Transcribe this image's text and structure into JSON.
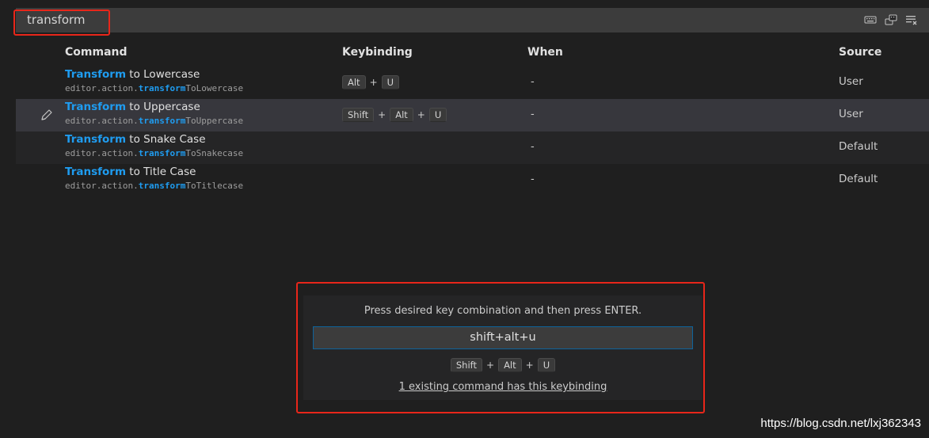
{
  "search": {
    "value": "transform"
  },
  "toolbar": {
    "icons": [
      "keyboard-icon",
      "record-keys-icon",
      "clear-search-icon"
    ]
  },
  "table": {
    "headers": {
      "command": "Command",
      "keybinding": "Keybinding",
      "when": "When",
      "source": "Source"
    },
    "rows": [
      {
        "title_hl": "Transform",
        "title_rest": " to Lowercase",
        "id_prefix": "editor.action.",
        "id_hl": "transform",
        "id_rest": "ToLowercase",
        "keys": [
          "Alt",
          "U"
        ],
        "when": "-",
        "source": "User"
      },
      {
        "title_hl": "Transform",
        "title_rest": " to Uppercase",
        "id_prefix": "editor.action.",
        "id_hl": "transform",
        "id_rest": "ToUppercase",
        "keys": [
          "Shift",
          "Alt",
          "U"
        ],
        "when": "-",
        "source": "User"
      },
      {
        "title_hl": "Transform",
        "title_rest": " to Snake Case",
        "id_prefix": "editor.action.",
        "id_hl": "transform",
        "id_rest": "ToSnakecase",
        "keys": [],
        "when": "-",
        "source": "Default"
      },
      {
        "title_hl": "Transform",
        "title_rest": " to Title Case",
        "id_prefix": "editor.action.",
        "id_hl": "transform",
        "id_rest": "ToTitlecase",
        "keys": [],
        "when": "-",
        "source": "Default"
      }
    ]
  },
  "dialog": {
    "message": "Press desired key combination and then press ENTER.",
    "input_value": "shift+alt+u",
    "keys": [
      "Shift",
      "Alt",
      "U"
    ],
    "existing_link": "1 existing command has this keybinding"
  },
  "plus_sign": "+",
  "watermark": "https://blog.csdn.net/lxj362343",
  "colors": {
    "highlight": "#1f9cf0",
    "annotation": "#e8261a",
    "focus_border": "#0e639c"
  }
}
